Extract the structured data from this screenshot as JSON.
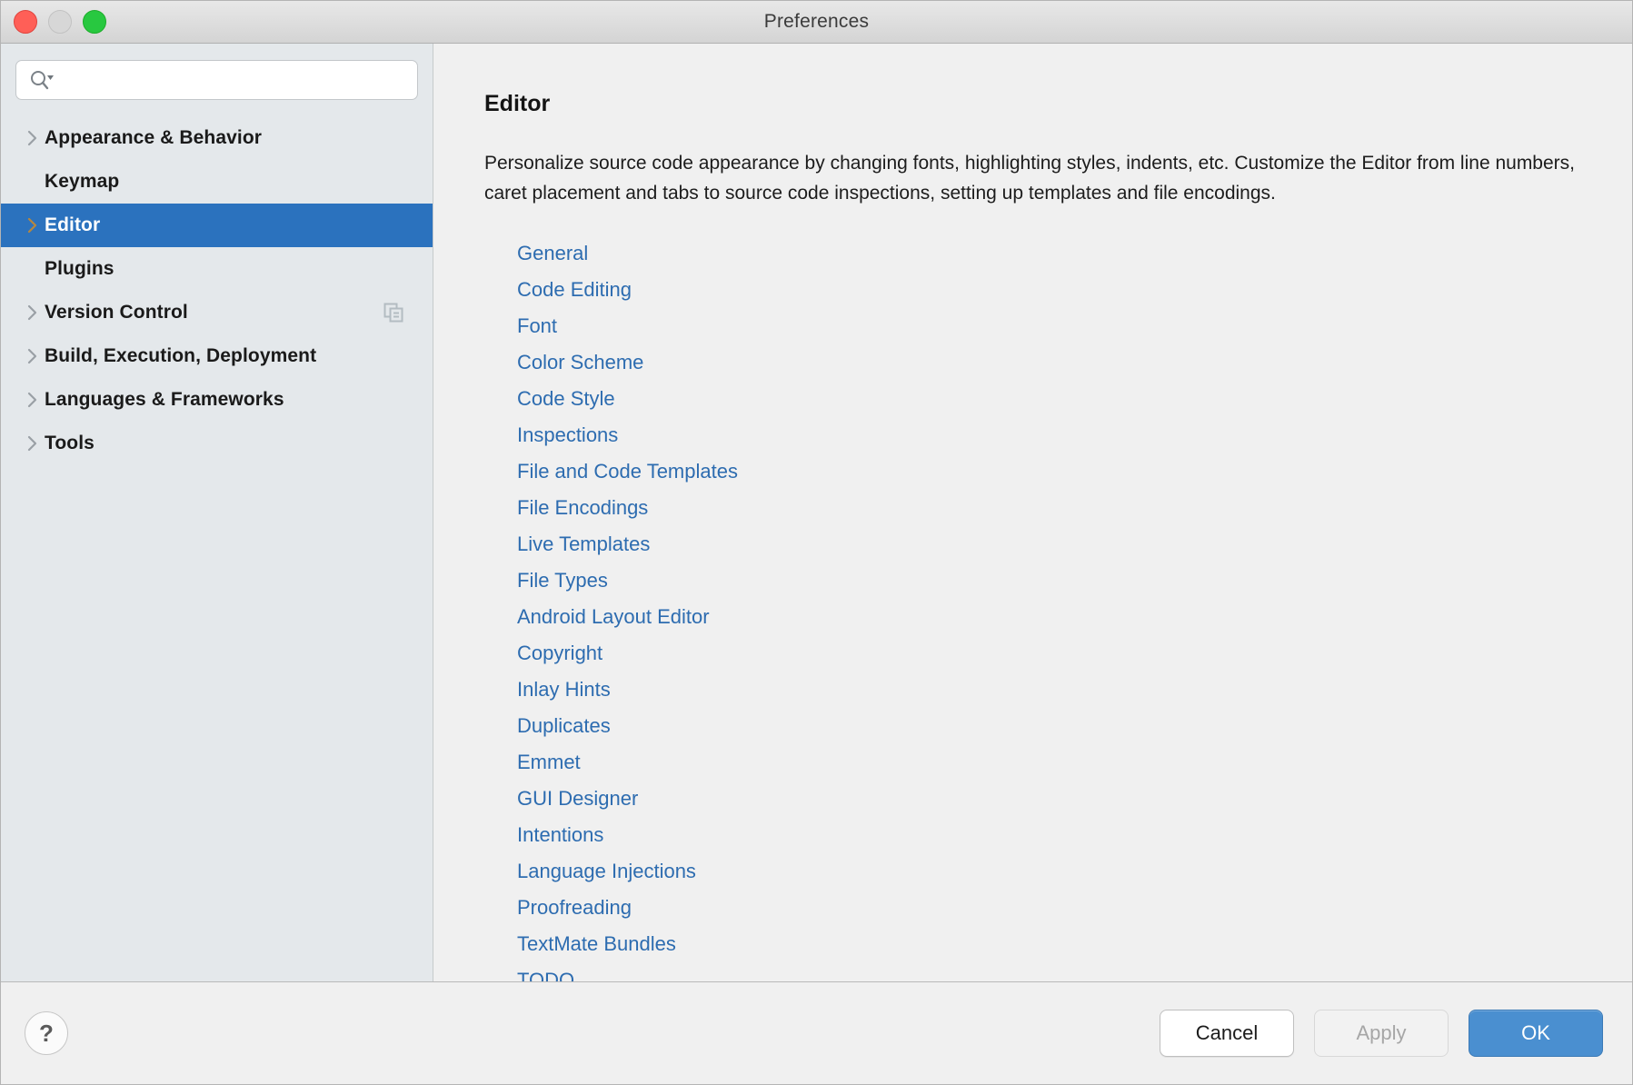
{
  "window": {
    "title": "Preferences",
    "traffic_lights": [
      "close-button",
      "minimize-button",
      "maximize-button"
    ]
  },
  "sidebar": {
    "search": {
      "value": "",
      "placeholder": "",
      "icon": "search-icon",
      "dropdown_icon": "chevron-down-icon"
    },
    "items": [
      {
        "label": "Appearance & Behavior",
        "expandable": true,
        "selected": false,
        "badge": null
      },
      {
        "label": "Keymap",
        "expandable": false,
        "selected": false,
        "badge": null
      },
      {
        "label": "Editor",
        "expandable": true,
        "selected": true,
        "badge": null
      },
      {
        "label": "Plugins",
        "expandable": false,
        "selected": false,
        "badge": null
      },
      {
        "label": "Version Control",
        "expandable": true,
        "selected": false,
        "badge": "copy-icon"
      },
      {
        "label": "Build, Execution, Deployment",
        "expandable": true,
        "selected": false,
        "badge": null
      },
      {
        "label": "Languages & Frameworks",
        "expandable": true,
        "selected": false,
        "badge": null
      },
      {
        "label": "Tools",
        "expandable": true,
        "selected": false,
        "badge": null
      }
    ]
  },
  "main": {
    "title": "Editor",
    "description": "Personalize source code appearance by changing fonts, highlighting styles, indents, etc. Customize the Editor from line numbers, caret placement and tabs to source code inspections, setting up templates and file encodings.",
    "links": [
      "General",
      "Code Editing",
      "Font",
      "Color Scheme",
      "Code Style",
      "Inspections",
      "File and Code Templates",
      "File Encodings",
      "Live Templates",
      "File Types",
      "Android Layout Editor",
      "Copyright",
      "Inlay Hints",
      "Duplicates",
      "Emmet",
      "GUI Designer",
      "Intentions",
      "Language Injections",
      "Proofreading",
      "TextMate Bundles",
      "TODO"
    ]
  },
  "footer": {
    "help_label": "?",
    "cancel_label": "Cancel",
    "apply_label": "Apply",
    "apply_enabled": false,
    "ok_label": "OK"
  },
  "colors": {
    "selection_blue": "#2b72be",
    "link_blue": "#2d6cb0",
    "ok_blue": "#4a8fd0",
    "sidebar_bg": "#e4e8eb",
    "panel_bg": "#f0f0f0"
  }
}
